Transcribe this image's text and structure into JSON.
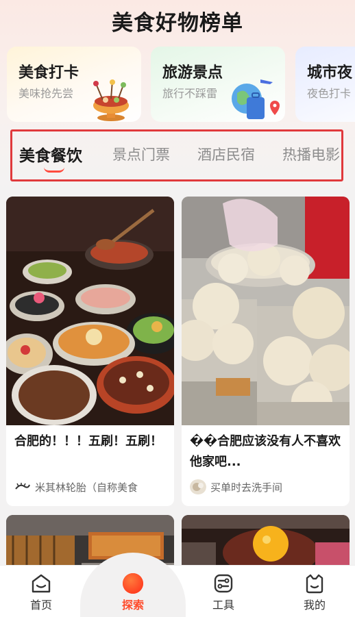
{
  "page": {
    "title": "美食好物榜单"
  },
  "categories": [
    {
      "title": "美食打卡",
      "subtitle": "美味抢先尝",
      "icon": "hotpot-illustration"
    },
    {
      "title": "旅游景点",
      "subtitle": "旅行不踩雷",
      "icon": "globe-suitcase-illustration"
    },
    {
      "title": "城市夜",
      "subtitle": "夜色打卡",
      "icon": "city-night-illustration"
    }
  ],
  "tabs": [
    {
      "label": "美食餐饮",
      "active": true
    },
    {
      "label": "景点门票",
      "active": false
    },
    {
      "label": "酒店民宿",
      "active": false
    },
    {
      "label": "热播电影",
      "active": false
    }
  ],
  "feed": [
    {
      "title": "合肥的！！！五刷！五刷！",
      "author": "米其林轮胎（自称美食",
      "image": "food-spread-photo"
    },
    {
      "title": "��合肥应该没有人不喜欢他家吧...",
      "author": "买单时去洗手间",
      "image": "steamed-buns-photo"
    },
    {
      "image": "grill-stall-photo"
    },
    {
      "image": "egg-yolk-beef-photo"
    }
  ],
  "bottom_nav": [
    {
      "label": "首页",
      "icon": "home-icon",
      "active": false
    },
    {
      "label": "探索",
      "icon": "explore-icon",
      "active": true
    },
    {
      "label": "工具",
      "icon": "tools-icon",
      "active": false
    },
    {
      "label": "我的",
      "icon": "profile-icon",
      "active": false
    }
  ],
  "colors": {
    "accent": "#ff4b2b",
    "highlight_border": "#e0393c"
  }
}
